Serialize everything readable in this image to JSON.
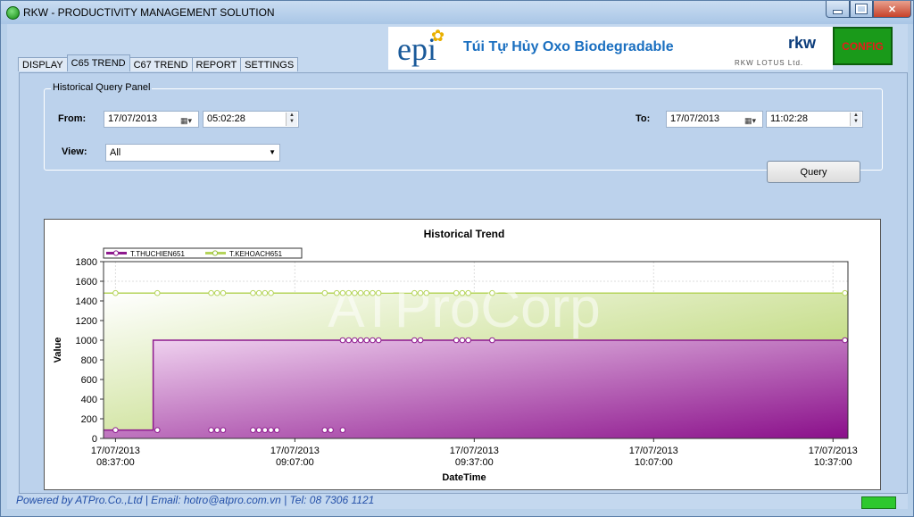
{
  "window": {
    "title": "RKW - PRODUCTIVITY MANAGEMENT SOLUTION"
  },
  "banner": {
    "logo": "epi",
    "text": "Túi Tự Hủy Oxo Biodegradable",
    "brand": "rkw",
    "brand_sub": "RKW LOTUS Ltd."
  },
  "config_label": "CONFIG",
  "tabs": [
    "DISPLAY",
    "C65 TREND",
    "C67 TREND",
    "REPORT",
    "SETTINGS"
  ],
  "active_tab": "C65 TREND",
  "panel": {
    "title": "Historical Query Panel",
    "from_label": "From:",
    "from_date": "17/07/2013",
    "from_time": "05:02:28",
    "to_label": "To:",
    "to_date": "17/07/2013",
    "to_time": "11:02:28",
    "view_label": "View:",
    "view_value": "All",
    "query_label": "Query"
  },
  "chart_data": {
    "type": "area",
    "title": "Historical Trend",
    "xlabel": "DateTime",
    "ylabel": "Value",
    "ylim": [
      0,
      1800
    ],
    "yticks": [
      0,
      200,
      400,
      600,
      800,
      1000,
      1200,
      1400,
      1600,
      1800
    ],
    "xticks": [
      {
        "date": "17/07/2013",
        "time": "08:37:00",
        "minutes": 0
      },
      {
        "date": "17/07/2013",
        "time": "09:07:00",
        "minutes": 30
      },
      {
        "date": "17/07/2013",
        "time": "09:37:00",
        "minutes": 60
      },
      {
        "date": "17/07/2013",
        "time": "10:07:00",
        "minutes": 90
      },
      {
        "date": "17/07/2013",
        "time": "10:37:00",
        "minutes": 120
      }
    ],
    "xrange_minutes": [
      -2,
      122.5
    ],
    "watermark": "ATProCorp",
    "legend_position": "top-left",
    "colors": {
      "plan": "#b5d45a",
      "actual": "#8e1a8e"
    },
    "series": [
      {
        "name": "T.THUCHIEN651",
        "steps": [
          [
            -2,
            85
          ],
          [
            6.3,
            85
          ],
          [
            6.3,
            1000
          ],
          [
            122.5,
            1000
          ]
        ],
        "markers": [
          [
            0,
            85
          ],
          [
            7,
            85
          ],
          [
            16,
            85
          ],
          [
            17,
            85
          ],
          [
            18,
            85
          ],
          [
            23,
            85
          ],
          [
            24,
            85
          ],
          [
            25,
            85
          ],
          [
            26,
            85
          ],
          [
            27,
            85
          ],
          [
            35,
            85
          ],
          [
            36,
            85
          ],
          [
            38,
            85
          ],
          [
            38,
            1000
          ],
          [
            39,
            1000
          ],
          [
            40,
            1000
          ],
          [
            41,
            1000
          ],
          [
            42,
            1000
          ],
          [
            43,
            1000
          ],
          [
            44,
            1000
          ],
          [
            50,
            1000
          ],
          [
            51,
            1000
          ],
          [
            57,
            1000
          ],
          [
            58,
            1000
          ],
          [
            59,
            1000
          ],
          [
            63,
            1000
          ],
          [
            122,
            1000
          ]
        ]
      },
      {
        "name": "T.KEHOACH651",
        "steps": [
          [
            -2,
            1480
          ],
          [
            122.5,
            1480
          ]
        ],
        "markers": [
          [
            0,
            1480
          ],
          [
            7,
            1480
          ],
          [
            16,
            1480
          ],
          [
            17,
            1480
          ],
          [
            18,
            1480
          ],
          [
            23,
            1480
          ],
          [
            24,
            1480
          ],
          [
            25,
            1480
          ],
          [
            26,
            1480
          ],
          [
            35,
            1480
          ],
          [
            37,
            1480
          ],
          [
            38,
            1480
          ],
          [
            39,
            1480
          ],
          [
            40,
            1480
          ],
          [
            41,
            1480
          ],
          [
            42,
            1480
          ],
          [
            43,
            1480
          ],
          [
            44,
            1480
          ],
          [
            50,
            1480
          ],
          [
            51,
            1480
          ],
          [
            52,
            1480
          ],
          [
            57,
            1480
          ],
          [
            58,
            1480
          ],
          [
            59,
            1480
          ],
          [
            63,
            1480
          ],
          [
            122,
            1480
          ]
        ]
      }
    ]
  },
  "footer": "Powered by ATPro.Co.,Ltd | Email: hotro@atpro.com.vn | Tel: 08 7306 1121",
  "status_color": "#2ec82e"
}
